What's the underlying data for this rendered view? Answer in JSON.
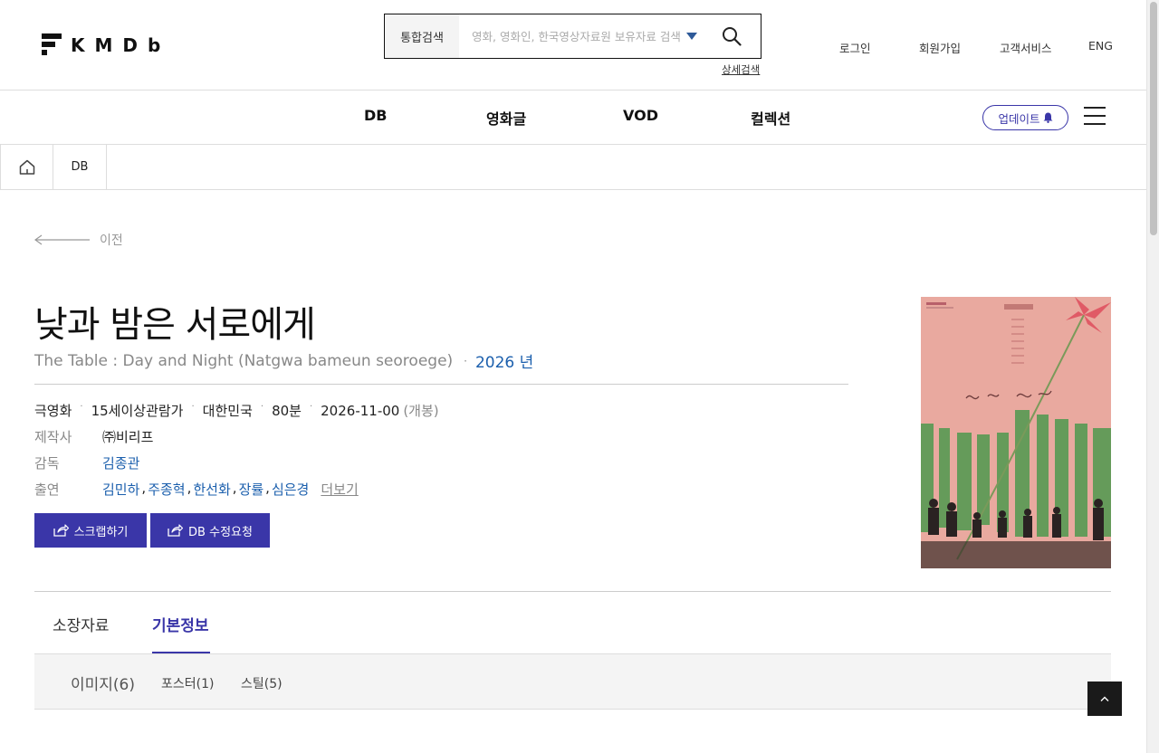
{
  "header": {
    "logo_text": "KMDb",
    "search": {
      "category": "통합검색",
      "placeholder": "영화, 영화인, 한국영상자료원 보유자료 검색",
      "advanced": "상세검색"
    },
    "util_nav": [
      "로그인",
      "회원가입",
      "고객서비스",
      "ENG"
    ]
  },
  "gnb": {
    "items": [
      "DB",
      "영화글",
      "VOD",
      "컬렉션"
    ],
    "update_label": "업데이트"
  },
  "breadcrumb": {
    "current": "DB"
  },
  "back_label": "이전",
  "movie": {
    "title": "낮과 밤은 서로에게",
    "title_en": "The Table : Day and Night (Natgwa bameun seoroege)",
    "year": "2026 년",
    "meta": [
      "극영화",
      "15세이상관람가",
      "대한민국",
      "80분",
      "2026-11-00"
    ],
    "release_note": "(개봉)",
    "producer_label": "제작사",
    "producer": "㈜비리프",
    "director_label": "감독",
    "director": "김종관",
    "cast_label": "출연",
    "cast": [
      "김민하",
      "주종혁",
      "한선화",
      "장률",
      "심은경"
    ],
    "more_label": "더보기"
  },
  "actions": {
    "scrap": "스크랩하기",
    "edit": "DB 수정요청"
  },
  "tabs": [
    "소장자료",
    "기본정보"
  ],
  "subtabs": {
    "main": "이미지(6)",
    "items": [
      "포스터(1)",
      "스틸(5)"
    ]
  },
  "colors": {
    "accent": "#3a36a8",
    "link": "#1b5fad"
  }
}
